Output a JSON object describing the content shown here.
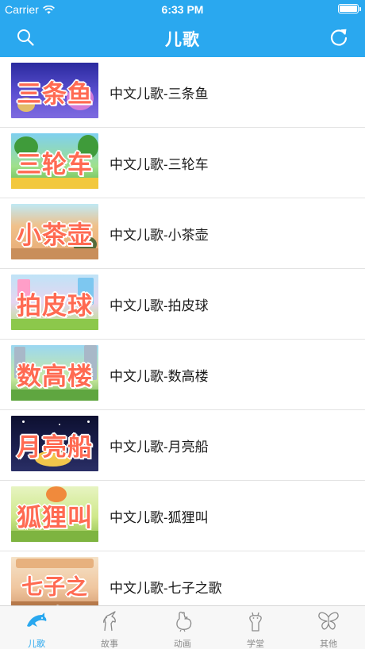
{
  "status_bar": {
    "carrier": "Carrier",
    "time": "6:33 PM"
  },
  "nav": {
    "title": "儿歌"
  },
  "songs": [
    {
      "thumb_text": "三条鱼",
      "title": "中文儿歌-三条鱼"
    },
    {
      "thumb_text": "三轮车",
      "title": "中文儿歌-三轮车"
    },
    {
      "thumb_text": "小茶壶",
      "title": "中文儿歌-小茶壶"
    },
    {
      "thumb_text": "拍皮球",
      "title": "中文儿歌-拍皮球"
    },
    {
      "thumb_text": "数高楼",
      "title": "中文儿歌-数高楼"
    },
    {
      "thumb_text": "月亮船",
      "title": "中文儿歌-月亮船"
    },
    {
      "thumb_text": "狐狸叫",
      "title": "中文儿歌-狐狸叫"
    },
    {
      "thumb_text": "七子之歌",
      "title": "中文儿歌-七子之歌"
    }
  ],
  "tabs": [
    {
      "label": "儿歌",
      "icon": "dolphin-icon",
      "active": true
    },
    {
      "label": "故事",
      "icon": "unicorn-icon",
      "active": false
    },
    {
      "label": "动画",
      "icon": "rooster-icon",
      "active": false
    },
    {
      "label": "学堂",
      "icon": "giraffe-icon",
      "active": false
    },
    {
      "label": "其他",
      "icon": "butterfly-icon",
      "active": false
    }
  ],
  "colors": {
    "accent": "#2AA8EF",
    "tab_inactive": "#8a8a8a",
    "thumb_text": "#ff6a52"
  }
}
